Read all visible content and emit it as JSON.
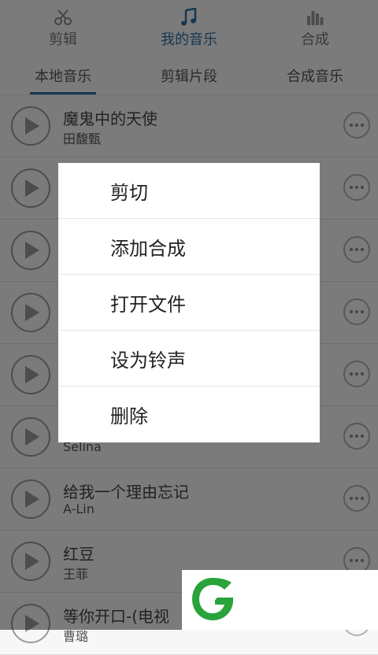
{
  "top_tabs": [
    {
      "label": "剪辑",
      "icon": "scissors-icon",
      "active": false
    },
    {
      "label": "我的音乐",
      "icon": "music-note-icon",
      "active": true
    },
    {
      "label": "合成",
      "icon": "equalizer-icon",
      "active": false
    }
  ],
  "sub_tabs": [
    {
      "label": "本地音乐",
      "active": true
    },
    {
      "label": "剪辑片段",
      "active": false
    },
    {
      "label": "合成音乐",
      "active": false
    }
  ],
  "songs": [
    {
      "title": "魔鬼中的天使",
      "artist": "田馥甄"
    },
    {
      "title": "",
      "artist": ""
    },
    {
      "title": "",
      "artist": ""
    },
    {
      "title": "",
      "artist": ""
    },
    {
      "title": "",
      "artist": ""
    },
    {
      "title": "",
      "artist": "Selina"
    },
    {
      "title": "给我一个理由忘记",
      "artist": "A-Lin"
    },
    {
      "title": "红豆",
      "artist": "王菲"
    },
    {
      "title": "等你开口-(电视",
      "artist": "曹璐"
    }
  ],
  "context_menu": {
    "items": [
      "剪切",
      "添加合成",
      "打开文件",
      "设为铃声",
      "删除"
    ]
  },
  "colors": {
    "accent": "#2d6ea3",
    "overlay": "rgba(0,0,0,0.5)",
    "logo_green": "#2aa33a"
  }
}
